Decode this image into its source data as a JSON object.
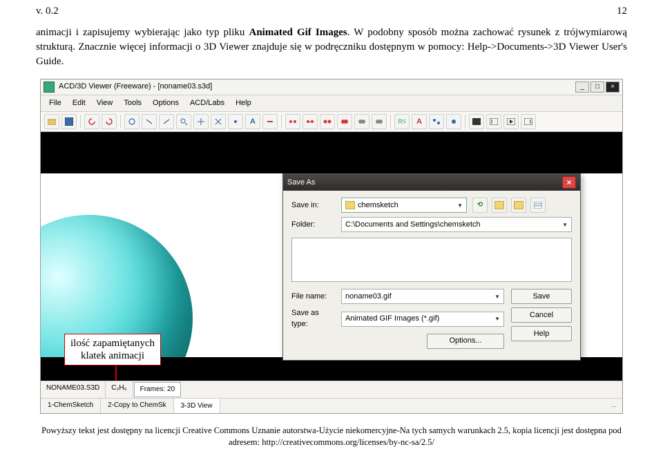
{
  "header": {
    "left": "v. 0.2",
    "right": "12"
  },
  "body": "animacji i zapisujemy wybierając jako typ pliku <b>Animated Gif Images</b>. W podobny sposób można zachować rysunek z trójwymiarową strukturą. Znacznie więcej informacji o 3D Viewer znajduje się w podręczniku dostępnym w pomocy: Help->Documents->3D Viewer User's Guide.",
  "app": {
    "title": "ACD/3D Viewer (Freeware) - [noname03.s3d]",
    "menus": [
      "File",
      "Edit",
      "View",
      "Tools",
      "Options",
      "ACD/Labs",
      "Help"
    ],
    "window_buttons": {
      "min": "_",
      "max": "□",
      "close": "×"
    }
  },
  "save_dialog": {
    "title": "Save As",
    "close": "×",
    "save_in_label": "Save in:",
    "save_in_value": "chemsketch",
    "folder_label": "Folder:",
    "folder_value": "C:\\Documents and Settings\\chemsketch",
    "filename_label": "File name:",
    "filename_value": "noname03.gif",
    "type_label": "Save as type:",
    "type_value": "Animated GIF Images (*.gif)",
    "options_label": "Options...",
    "save_btn": "Save",
    "cancel_btn": "Cancel",
    "help_btn": "Help"
  },
  "callout": {
    "line1": "ilość zapamiętanych",
    "line2": "klatek animacji"
  },
  "statusbar": {
    "file": "NONAME03.S3D",
    "formula": "C₂H₆",
    "frames": "Frames: 20"
  },
  "tabs": {
    "t1": "1-ChemSketch",
    "t2": "2-Copy to ChemSk",
    "t3": "3-3D View",
    "ellipsis": "..."
  },
  "footer": "Powyższy tekst jest dostępny na licencji Creative Commons Uznanie autorstwa-Użycie niekomercyjne-Na tych samych warunkach 2.5, kopia licencji jest dostępna pod adresem: http://creativecommons.org/licenses/by-nc-sa/2.5/"
}
